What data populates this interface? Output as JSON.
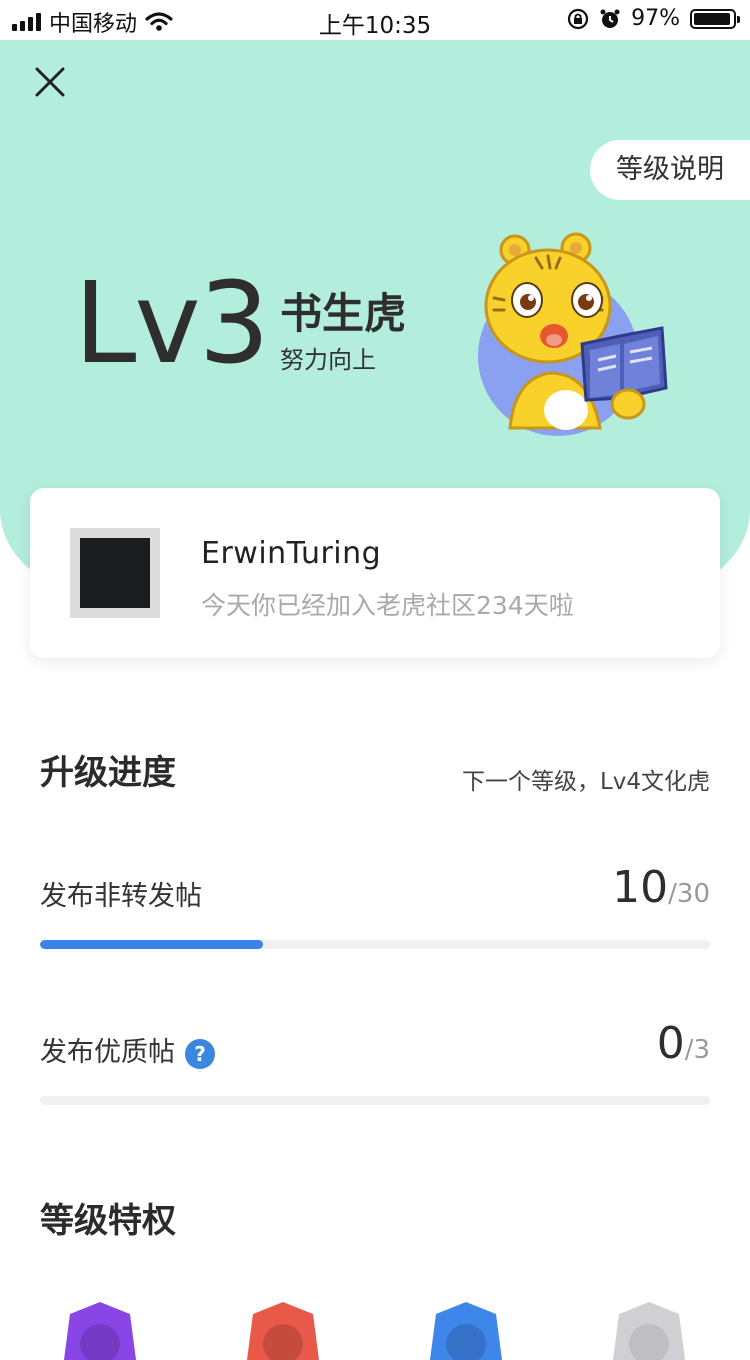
{
  "status_bar": {
    "carrier": "中国移动",
    "time": "上午10:35",
    "battery": "97%"
  },
  "header": {
    "level_explain_label": "等级说明"
  },
  "level": {
    "code": "Lv3",
    "name": "书生虎",
    "motto": "努力向上"
  },
  "user": {
    "name": "ErwinTuring",
    "join_text": "今天你已经加入老虎社区234天啦"
  },
  "progress": {
    "title": "升级进度",
    "next_level": "下一个等级，Lv4文化虎",
    "tasks": [
      {
        "label": "发布非转发帖",
        "current": "10",
        "total": "/30",
        "fraction": 0.333
      },
      {
        "label": "发布优质帖",
        "current": "0",
        "total": "/3",
        "fraction": 0,
        "help_icon": "question-icon"
      }
    ]
  },
  "privileges": {
    "title": "等级特权",
    "badge_colors": [
      "#8a45e6",
      "#e8594a",
      "#3f86ea",
      "#cfcfd4"
    ]
  },
  "colors": {
    "hero_bg": "#b3eddc",
    "progress_fill": "#3a82e8",
    "help_icon": "#3a86e0"
  }
}
